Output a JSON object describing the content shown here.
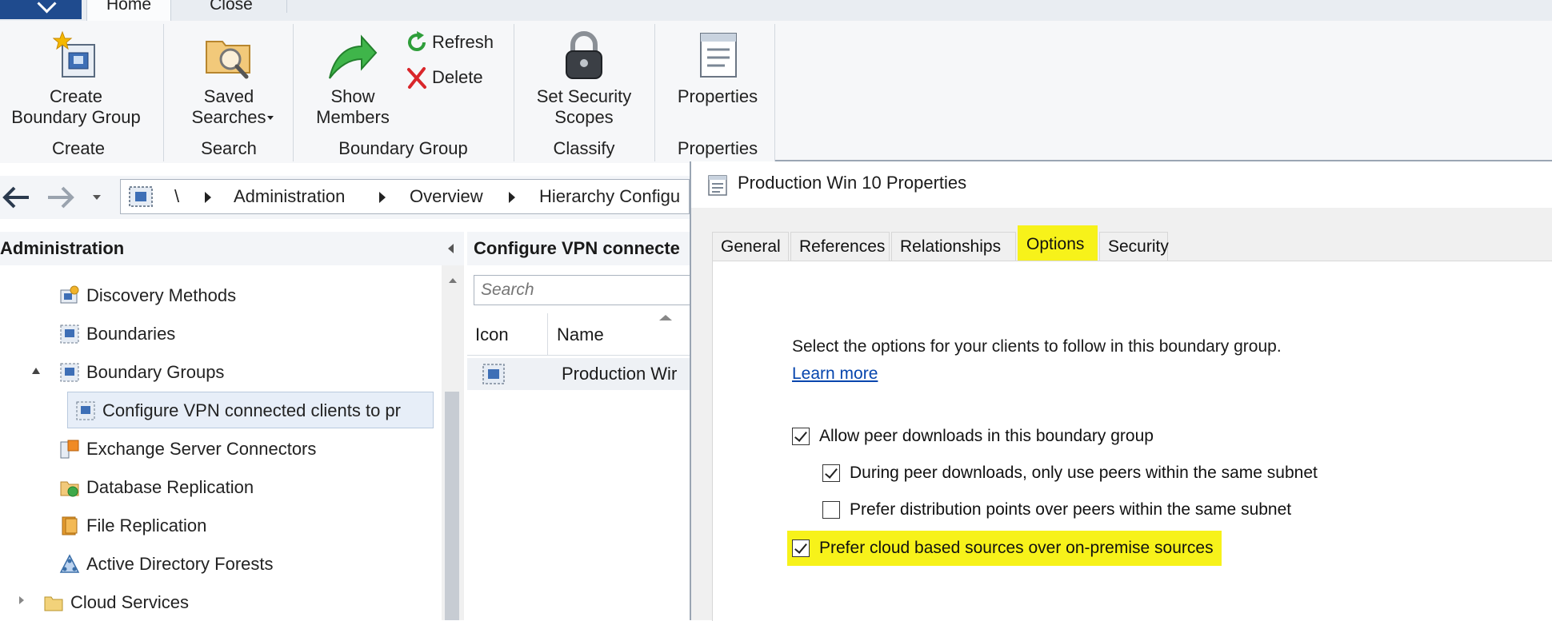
{
  "ribbon": {
    "tabs": [
      "Home",
      "Close"
    ],
    "buttons": {
      "create_boundary_group": "Create\nBoundary Group",
      "saved_searches": "Saved\nSearches",
      "show_members": "Show\nMembers",
      "refresh": "Refresh",
      "delete": "Delete",
      "set_security_scopes": "Set Security\nScopes",
      "properties": "Properties"
    },
    "groups": [
      "Create",
      "Search",
      "Boundary Group",
      "Classify",
      "Properties"
    ]
  },
  "navigation": {
    "breadcrumb": [
      "\\",
      "Administration",
      "Overview",
      "Hierarchy Configu"
    ]
  },
  "tree": {
    "header": "Administration",
    "items": [
      {
        "label": "Discovery Methods",
        "icon": "discovery-icon"
      },
      {
        "label": "Boundaries",
        "icon": "boundaries-icon"
      },
      {
        "label": "Boundary Groups",
        "icon": "boundary-group-icon"
      },
      {
        "label": "Configure VPN connected clients to pr",
        "icon": "boundary-group-icon"
      },
      {
        "label": "Exchange Server Connectors",
        "icon": "exchange-icon"
      },
      {
        "label": "Database Replication",
        "icon": "database-replication-icon"
      },
      {
        "label": "File Replication",
        "icon": "file-replication-icon"
      },
      {
        "label": "Active Directory Forests",
        "icon": "ad-forest-icon"
      },
      {
        "label": "Cloud Services",
        "icon": "folder-icon"
      }
    ]
  },
  "list": {
    "header": "Configure VPN connecte",
    "search_placeholder": "Search",
    "columns": [
      "Icon",
      "Name"
    ],
    "rows": [
      {
        "name": "Production Wir"
      }
    ]
  },
  "dialog": {
    "title": "Production Win 10 Properties",
    "tabs": [
      "General",
      "References",
      "Relationships",
      "Options",
      "Security"
    ],
    "active_tab": "Options",
    "description": "Select the options for your clients to follow in this boundary group.",
    "learn_more": "Learn more",
    "options": [
      {
        "label": "Allow peer downloads in this boundary group",
        "checked": true
      },
      {
        "label": "During peer downloads, only use peers within the same subnet",
        "checked": true
      },
      {
        "label": "Prefer distribution points over peers within the same subnet",
        "checked": false
      },
      {
        "label": "Prefer cloud based sources over on-premise sources",
        "checked": true
      }
    ],
    "highlight_color": "#f7f21a"
  }
}
